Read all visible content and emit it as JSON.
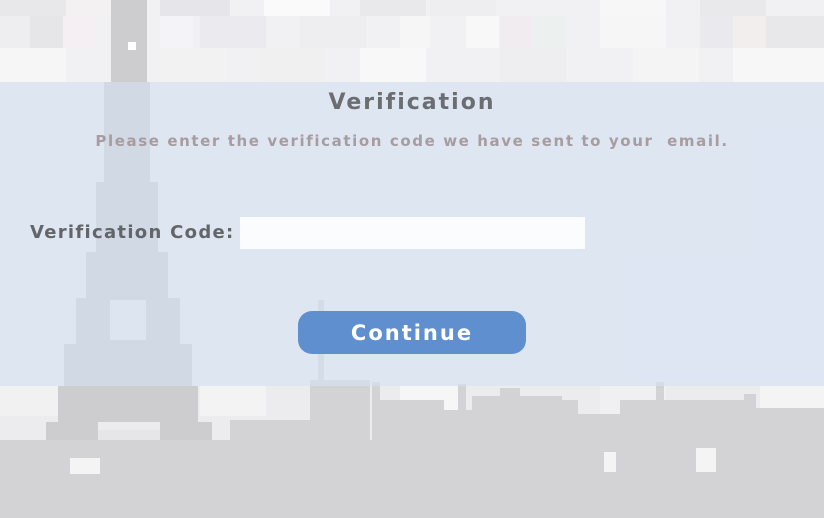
{
  "verification": {
    "title": "Verification",
    "subtitle": "Please enter the verification code we have sent to your  email.",
    "code_label": "Verification Code:",
    "code_value": "",
    "code_placeholder": "",
    "continue_label": "Continue"
  },
  "colors": {
    "panel": "#d6e4f8",
    "button": "#5f8fce",
    "title_text": "#6b6d71",
    "subtitle_text": "#a79c9f",
    "label_text": "#636568"
  },
  "icons": {
    "background": "pixel-art-paris-skyline-with-eiffel-tower"
  }
}
